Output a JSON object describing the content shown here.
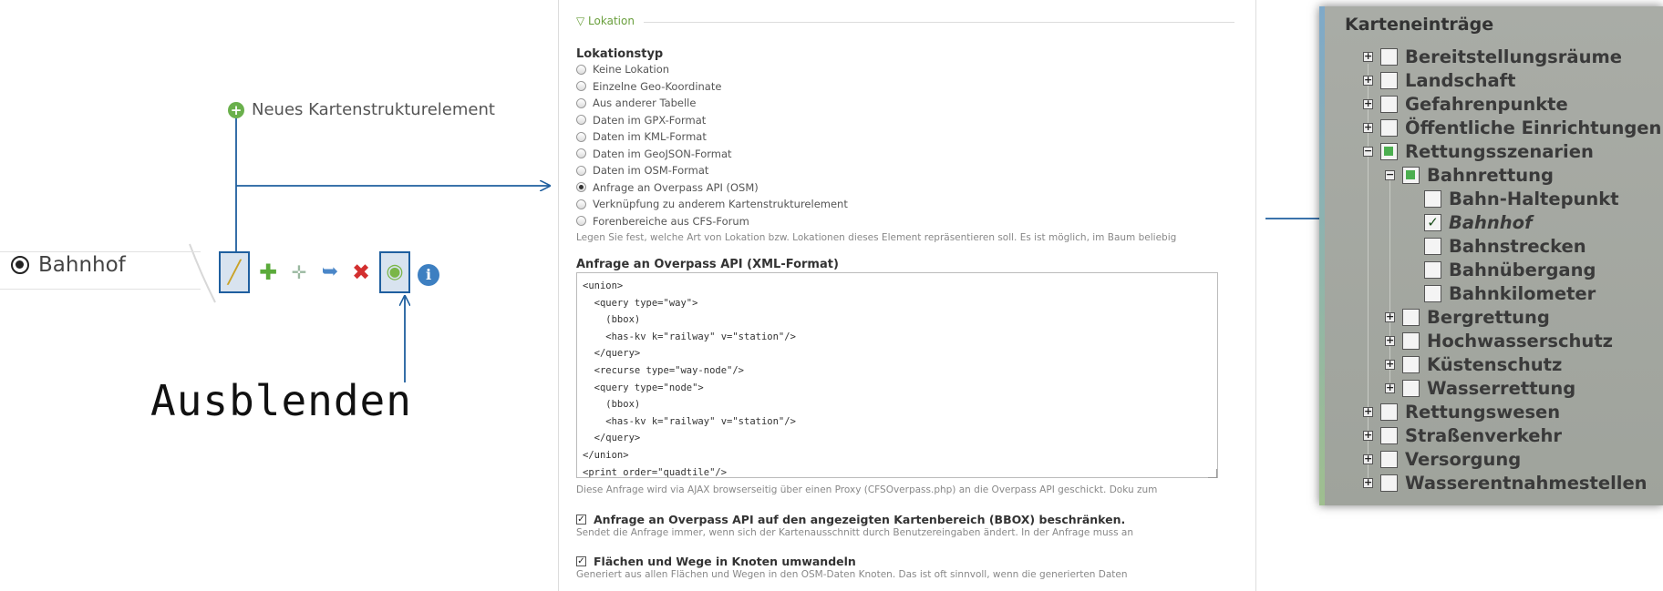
{
  "left": {
    "new_element_label": "Neues Kartenstrukturelement",
    "node_label": "Bahnhof",
    "annotation": "Ausblenden",
    "toolbar_icons": [
      "edit-icon",
      "add-icon",
      "add-child-icon",
      "move-icon",
      "delete-icon",
      "visibility-eye-icon",
      "info-icon"
    ]
  },
  "form": {
    "legend": "▽ Lokation",
    "location_type_label": "Lokationstyp",
    "options": [
      "Keine Lokation",
      "Einzelne Geo-Koordinate",
      "Aus anderer Tabelle",
      "Daten im GPX-Format",
      "Daten im KML-Format",
      "Daten im GeoJSON-Format",
      "Daten im OSM-Format",
      "Anfrage an Overpass API (OSM)",
      "Verknüpfung zu anderem Kartenstrukturelement",
      "Forenbereiche aus CFS-Forum"
    ],
    "selected_option": "Anfrage an Overpass API (OSM)",
    "option_hint": "Legen Sie fest, welche Art von Lokation bzw. Lokationen dieses Element repräsentieren soll. Es ist möglich, im Baum beliebig",
    "query_label": "Anfrage an Overpass API (XML-Format)",
    "query_text": "<union>\n  <query type=\"way\">\n    (bbox)\n    <has-kv k=\"railway\" v=\"station\"/>\n  </query>\n  <recurse type=\"way-node\"/>\n  <query type=\"node\">\n    (bbox)\n    <has-kv k=\"railway\" v=\"station\"/>\n  </query>\n</union>\n<print order=\"quadtile\"/>",
    "query_hint": "Diese Anfrage wird via AJAX browserseitig über einen Proxy (CFSOverpass.php) an die Overpass API geschickt. Doku zum",
    "bbox_label": "Anfrage an Overpass API auf den angezeigten Kartenbereich (BBOX) beschränken.",
    "bbox_hint": "Sendet die Anfrage immer, wenn sich der Kartenausschnitt durch Benutzereingaben ändert. In der Anfrage muss an",
    "nodes_label": "Flächen und Wege in Knoten umwandeln",
    "nodes_hint": "Generiert aus allen Flächen und Wegen in den OSM-Daten Knoten. Das ist oft sinnvoll, wenn die generierten Daten"
  },
  "tree": {
    "title": "Karteneinträge",
    "items": [
      {
        "label": "Bereitstellungsräume",
        "level": 0,
        "expander": "+",
        "check": "none"
      },
      {
        "label": "Landschaft",
        "level": 0,
        "expander": "+",
        "check": "none"
      },
      {
        "label": "Gefahrenpunkte",
        "level": 0,
        "expander": "+",
        "check": "none"
      },
      {
        "label": "Öffentliche Einrichtungen",
        "level": 0,
        "expander": "+",
        "check": "none"
      },
      {
        "label": "Rettungsszenarien",
        "level": 0,
        "expander": "−",
        "check": "partial"
      },
      {
        "label": "Bahnrettung",
        "level": 1,
        "expander": "−",
        "check": "partial"
      },
      {
        "label": "Bahn-Haltepunkt",
        "level": 2,
        "expander": "",
        "check": "none"
      },
      {
        "label": "Bahnhof",
        "level": 2,
        "expander": "",
        "check": "checked"
      },
      {
        "label": "Bahnstrecken",
        "level": 2,
        "expander": "",
        "check": "none"
      },
      {
        "label": "Bahnübergang",
        "level": 2,
        "expander": "",
        "check": "none"
      },
      {
        "label": "Bahnkilometer",
        "level": 2,
        "expander": "",
        "check": "none"
      },
      {
        "label": "Bergrettung",
        "level": 1,
        "expander": "+",
        "check": "none"
      },
      {
        "label": "Hochwasserschutz",
        "level": 1,
        "expander": "+",
        "check": "none"
      },
      {
        "label": "Küstenschutz",
        "level": 1,
        "expander": "+",
        "check": "none"
      },
      {
        "label": "Wasserrettung",
        "level": 1,
        "expander": "+",
        "check": "none"
      },
      {
        "label": "Rettungswesen",
        "level": 0,
        "expander": "+",
        "check": "none"
      },
      {
        "label": "Straßenverkehr",
        "level": 0,
        "expander": "+",
        "check": "none"
      },
      {
        "label": "Versorgung",
        "level": 0,
        "expander": "+",
        "check": "none"
      },
      {
        "label": "Wasserentnahmestellen",
        "level": 0,
        "expander": "+",
        "check": "none"
      }
    ]
  },
  "colors": {
    "accent_blue": "#1f5f9f",
    "green": "#6ab04c",
    "red": "#d32f2f"
  }
}
